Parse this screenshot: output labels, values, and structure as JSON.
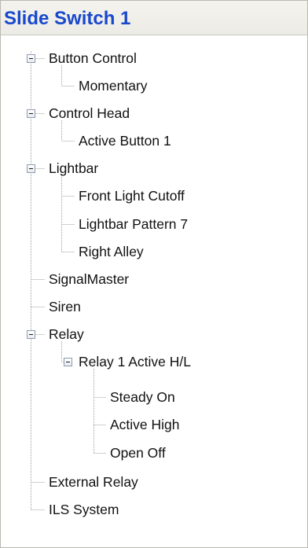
{
  "header": {
    "title": "Slide Switch 1"
  },
  "tree": {
    "button_control": {
      "label": "Button Control",
      "children": {
        "momentary": "Momentary"
      }
    },
    "control_head": {
      "label": "Control Head",
      "children": {
        "active_button_1": "Active Button 1"
      }
    },
    "lightbar": {
      "label": "Lightbar",
      "children": {
        "front_light_cutoff": "Front Light Cutoff",
        "lightbar_pattern_7": "Lightbar Pattern 7",
        "right_alley": "Right Alley"
      }
    },
    "signalmaster": {
      "label": "SignalMaster"
    },
    "siren": {
      "label": "Siren"
    },
    "relay": {
      "label": "Relay",
      "children": {
        "relay_1_active_hl": {
          "label": "Relay 1 Active H/L",
          "children": {
            "steady_on": "Steady On",
            "active_high": "Active High",
            "open_off": "Open Off"
          }
        }
      }
    },
    "external_relay": {
      "label": "External Relay"
    },
    "ils_system": {
      "label": "ILS System"
    }
  },
  "colors": {
    "title": "#1848cc",
    "text": "#111111",
    "tree_lines": "#a0a0a0",
    "expander_border": "#8e9aad"
  },
  "icons": {
    "expanded": "minus-box-icon"
  }
}
